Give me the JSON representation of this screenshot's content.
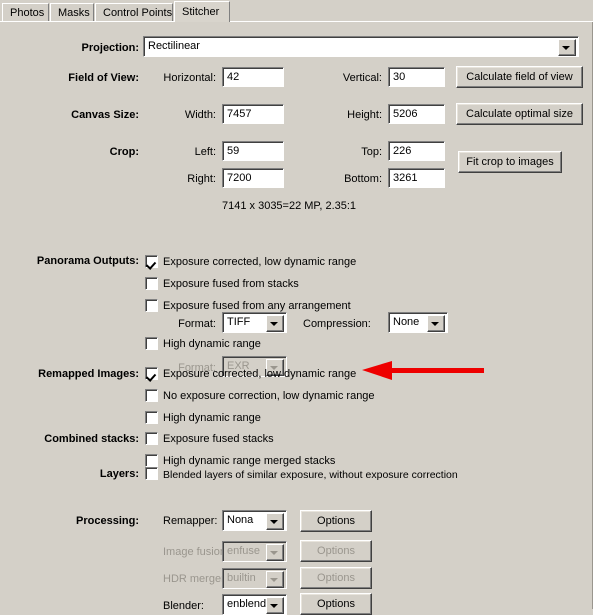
{
  "tabs": [
    {
      "label": "Photos",
      "selected": false
    },
    {
      "label": "Masks",
      "selected": false
    },
    {
      "label": "Control Points",
      "selected": false
    },
    {
      "label": "Stitcher",
      "selected": true
    }
  ],
  "projection": {
    "label": "Projection:",
    "value": "Rectilinear"
  },
  "field_of_view": {
    "label": "Field of View:",
    "horizontal_label": "Horizontal:",
    "horizontal_value": "42",
    "vertical_label": "Vertical:",
    "vertical_value": "30",
    "button": "Calculate field of view"
  },
  "canvas_size": {
    "label": "Canvas Size:",
    "width_label": "Width:",
    "width_value": "7457",
    "height_label": "Height:",
    "height_value": "5206",
    "button": "Calculate optimal size"
  },
  "crop": {
    "label": "Crop:",
    "left_label": "Left:",
    "left_value": "59",
    "top_label": "Top:",
    "top_value": "226",
    "right_label": "Right:",
    "right_value": "7200",
    "bottom_label": "Bottom:",
    "bottom_value": "3261",
    "button": "Fit crop to images",
    "summary": "7141 x 3035=22 MP, 2.35:1"
  },
  "panorama_outputs": {
    "label": "Panorama Outputs:",
    "items": [
      {
        "label": "Exposure corrected, low dynamic range",
        "checked": true
      },
      {
        "label": "Exposure fused from stacks",
        "checked": false
      },
      {
        "label": "Exposure fused from any arrangement",
        "checked": false
      }
    ],
    "format_label": "Format:",
    "format_value": "TIFF",
    "compression_label": "Compression:",
    "compression_value": "None",
    "hdr_label": "High dynamic range",
    "hdr_checked": false,
    "hdr_format_label": "Format:",
    "hdr_format_value": "EXR"
  },
  "remapped_images": {
    "label": "Remapped Images:",
    "items": [
      {
        "label": "Exposure corrected, low dynamic range",
        "checked": true
      },
      {
        "label": "No exposure correction, low dynamic range",
        "checked": false
      },
      {
        "label": "High dynamic range",
        "checked": false
      }
    ]
  },
  "combined_stacks": {
    "label": "Combined stacks:",
    "items": [
      {
        "label": "Exposure fused stacks",
        "checked": false
      },
      {
        "label": "High dynamic range merged stacks",
        "checked": false
      }
    ]
  },
  "layers": {
    "label": "Layers:",
    "items": [
      {
        "label": "Blended layers of similar exposure, without exposure correction",
        "checked": false
      }
    ]
  },
  "processing": {
    "label": "Processing:",
    "rows": [
      {
        "label": "Remapper:",
        "value": "Nona",
        "button": "Options",
        "disabled": false
      },
      {
        "label": "Image fusion:",
        "value": "enfuse",
        "button": "Options",
        "disabled": true
      },
      {
        "label": "HDR merger:",
        "value": "builtin",
        "button": "Options",
        "disabled": true
      },
      {
        "label": "Blender:",
        "value": "enblend",
        "button": "Options",
        "disabled": false
      }
    ]
  },
  "annotation": {
    "arrow_color": "#ee0000",
    "points_at": "Remapped Images: Exposure corrected, low dynamic range"
  },
  "colors": {
    "window_background": "#d4d0c8",
    "field_background": "#ffffff",
    "disabled_text": "#9a968e",
    "accent_red": "#ee0000"
  }
}
